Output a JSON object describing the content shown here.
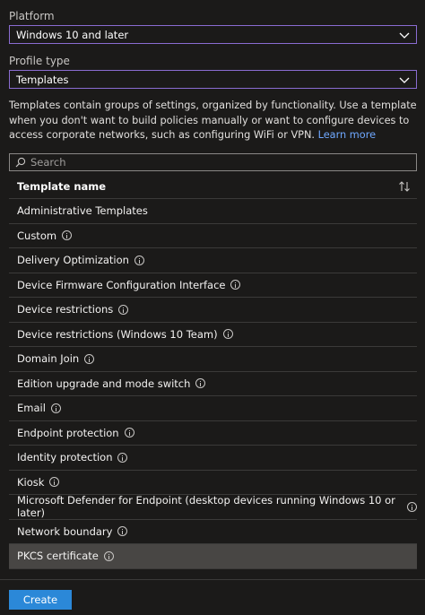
{
  "platform": {
    "label": "Platform",
    "value": "Windows 10 and later"
  },
  "profile_type": {
    "label": "Profile type",
    "value": "Templates"
  },
  "description": {
    "text": "Templates contain groups of settings, organized by functionality. Use a template when you don't want to build policies manually or want to configure devices to access corporate networks, such as configuring WiFi or VPN.",
    "link": "Learn more"
  },
  "search": {
    "placeholder": "Search",
    "icon": "search-icon"
  },
  "table": {
    "header": "Template name",
    "sort_icon": "sort-arrows-icon",
    "rows": [
      {
        "name": "Administrative Templates",
        "info": false
      },
      {
        "name": "Custom",
        "info": true
      },
      {
        "name": "Delivery Optimization",
        "info": true
      },
      {
        "name": "Device Firmware Configuration Interface",
        "info": true
      },
      {
        "name": "Device restrictions",
        "info": true
      },
      {
        "name": "Device restrictions (Windows 10 Team)",
        "info": true
      },
      {
        "name": "Domain Join",
        "info": true
      },
      {
        "name": "Edition upgrade and mode switch",
        "info": true
      },
      {
        "name": "Email",
        "info": true
      },
      {
        "name": "Endpoint protection",
        "info": true
      },
      {
        "name": "Identity protection",
        "info": true
      },
      {
        "name": "Kiosk",
        "info": true
      },
      {
        "name": "Microsoft Defender for Endpoint (desktop devices running Windows 10 or later)",
        "info": true
      },
      {
        "name": "Network boundary",
        "info": true
      },
      {
        "name": "PKCS certificate",
        "info": true,
        "selected": true
      }
    ]
  },
  "footer": {
    "create_label": "Create"
  },
  "colors": {
    "accent": "#2b88d8",
    "select_border": "#8a6cd1",
    "link": "#6fa8ff",
    "background": "#1b1a19"
  }
}
